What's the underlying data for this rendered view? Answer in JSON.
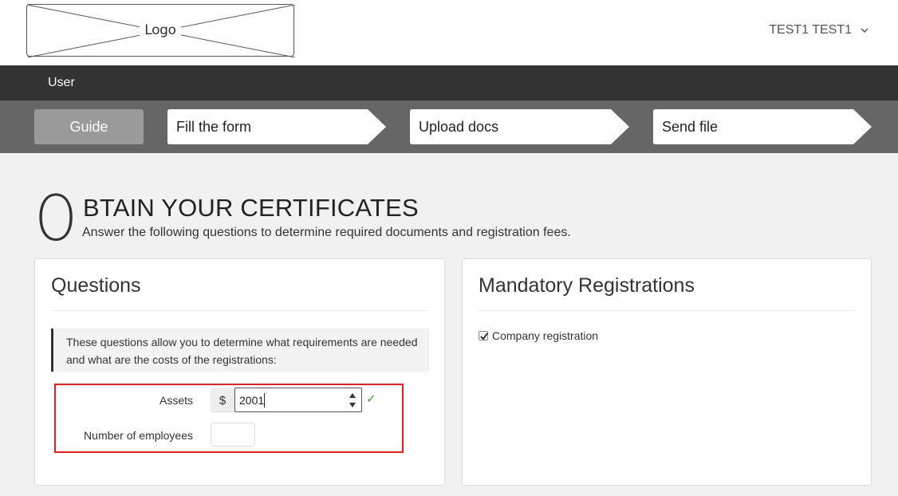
{
  "header": {
    "logo_text": "Logo",
    "user_name": "TEST1 TEST1"
  },
  "nav": {
    "user_label": "User"
  },
  "steps": {
    "guide": "Guide",
    "items": [
      {
        "label": "Fill the form"
      },
      {
        "label": "Upload docs"
      },
      {
        "label": "Send file"
      }
    ]
  },
  "page": {
    "title_initial": "O",
    "title_rest": "BTAIN YOUR CERTIFICATES",
    "subtitle": "Answer the following questions to determine required documents and registration fees."
  },
  "questions": {
    "title": "Questions",
    "info": "These questions allow you to determine what requirements are needed and what are the costs of the registrations:",
    "assets_label": "Assets",
    "currency_symbol": "$",
    "assets_value": "2001",
    "employees_label": "Number of employees",
    "employees_value": ""
  },
  "mandatory": {
    "title": "Mandatory Registrations",
    "items": [
      {
        "label": "Company registration",
        "checked": true
      }
    ]
  },
  "colors": {
    "nav_bg": "#333333",
    "steps_bg": "#666666",
    "guide_bg": "#9a9a9a",
    "highlight_border": "#e02020",
    "check_green": "#3c9a3c"
  }
}
